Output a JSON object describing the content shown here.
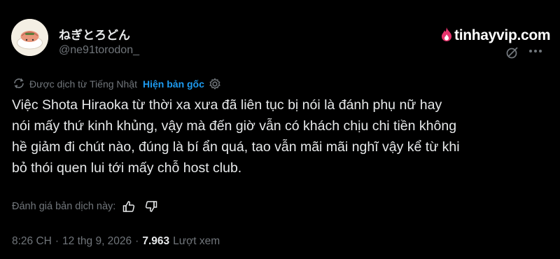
{
  "author": {
    "display_name": "ねぎとろどん",
    "handle": "@ne91torodon_"
  },
  "watermark": {
    "text": "tinhayvip.com",
    "color": "#e8336d"
  },
  "translation": {
    "label": "Được dịch từ Tiếng Nhật",
    "show_original": "Hiện bản gốc",
    "link_color": "#1d9bf0"
  },
  "tweet": {
    "lines": [
      "Việc Shota Hiraoka từ thời xa xưa đã liên tục bị nói là đánh phụ nữ hay",
      "nói mấy thứ kinh khủng, vậy mà đến giờ vẫn có khách chịu chi tiền không",
      "hề giảm đi chút nào, đúng là bí ẩn quá, tao vẫn mãi mãi nghĩ vậy kể từ khi",
      "bỏ thói quen lui tới mấy chỗ host club."
    ]
  },
  "rating": {
    "label": "Đánh giá bản dịch này:"
  },
  "meta": {
    "time": "8:26 CH",
    "separator": "·",
    "date": "12 thg 9, 2026",
    "views_count": "7.963",
    "views_label": "Lượt xem"
  },
  "icons": {
    "translate": "translate-icon",
    "settings": "gear-icon",
    "thumbs_up": "thumbs-up-icon",
    "thumbs_down": "thumbs-down-icon",
    "grok": "grok-icon",
    "more": "more-icon"
  }
}
